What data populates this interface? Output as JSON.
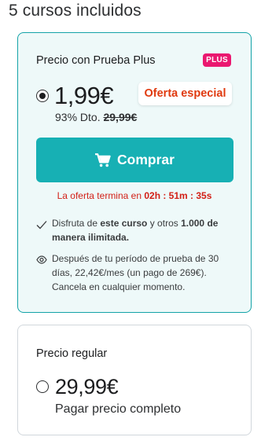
{
  "heading": "5 cursos incluidos",
  "plus_plan": {
    "title": "Precio con Prueba Plus",
    "badge": "PLUS",
    "price": "1,99€",
    "offer_badge": "Oferta especial",
    "discount_label": "93% Dto.",
    "original_price": "29,99€",
    "buy_label": "Comprar",
    "timer_prefix": "La oferta termina en ",
    "timer_value": "02h : 51m : 35s",
    "feature1": {
      "t1": "Disfruta de ",
      "b1": "este curso",
      "t2": " y otros ",
      "b2": "1.000 de manera ilimitada."
    },
    "feature2": "Después de tu período de prueba de 30 días, 22,42€/mes (un pago de 269€). Cancela en cualquier momento.",
    "selected": true
  },
  "regular_plan": {
    "title": "Precio regular",
    "price": "29,99€",
    "subtitle": "Pagar precio completo",
    "selected": false
  },
  "colors": {
    "accent": "#17b0b4",
    "card_bg": "#eef9f9",
    "plus_badge": "#ea1870",
    "offer_red": "#e03a0f",
    "timer_red": "#d21f16"
  }
}
